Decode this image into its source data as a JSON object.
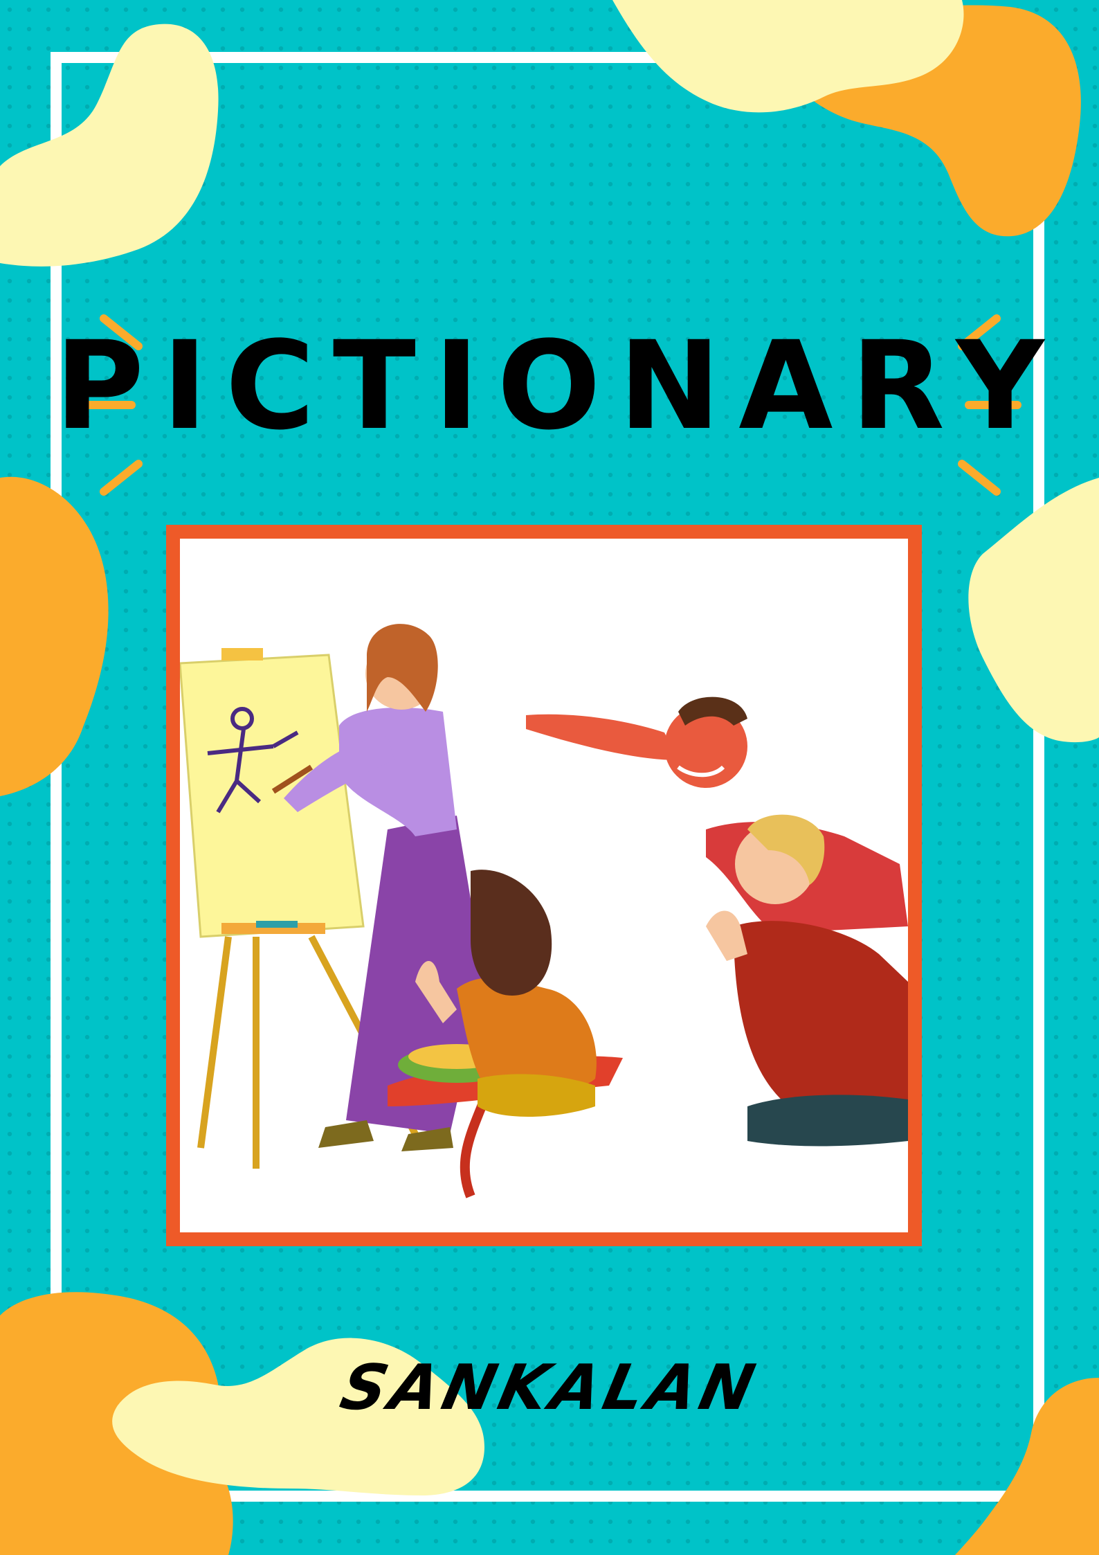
{
  "poster": {
    "title": "PICTIONARY",
    "brand": "SANKALAN"
  },
  "colors": {
    "background": "#00c3c8",
    "dots": "#00a9ae",
    "border": "#ffffff",
    "blob_orange": "#fbab2c",
    "blob_cream": "#fdf7b3",
    "accent_rays": "#fbab2c",
    "frame": "#ee5a28",
    "title_text": "#000000"
  },
  "illustration": {
    "subject": "people-playing-pictionary-icon"
  }
}
